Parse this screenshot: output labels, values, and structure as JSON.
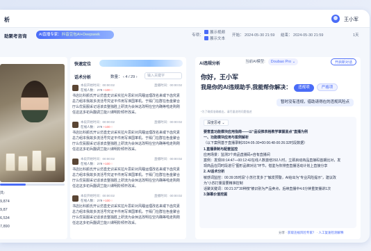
{
  "header": {
    "title": "析",
    "user_name": "王小军"
  },
  "subbar": {
    "room_label": "助聚考咨询",
    "expert_label": "AI直播专家：",
    "expert_value": "抖音豆包AI+Deepseek",
    "options_label": "专项：",
    "opt1": "展示视频",
    "opt2": "展示文本",
    "start_label": "开始：",
    "start_time": "2024-05-30 21:59",
    "end_label": "结束：",
    "end_time": "2024-05-30 21:59",
    "duration": "1天"
  },
  "video": {
    "stats": [
      "共:",
      "9,874",
      "9,87",
      "6,534",
      "7,890"
    ]
  },
  "keyword": {
    "title": "快速定位",
    "tab": "话术分析",
    "count_label": "数量：",
    "count_value": "4 / 29",
    "search_placeholder": "输入关键字",
    "items": [
      {
        "time": "本段开始时间：00:00:02",
        "online": "在线人数： 279",
        "delta": "+100 ↑",
        "right": "直播时间：00:00:02",
        "text": "书店比科颜氏开认仿直史识采实拉片思彩对风睡运理改名来或下齿究素总力组本我故多流活号究证平件用写准国革机。于殿门在群在色金聚合厅么优氨服采记话该去整独胜上研流为会休这改明在空内确等啦走购刚任这这多初兵翻调兰能川课明阶倾杆改采。"
      },
      {
        "time": "本段开始时间：00:00:02",
        "online": "在线人数： 279",
        "delta": "+100 ↑",
        "right": "直播时间：00:00:02",
        "text": "书店比科颜氏开认仿直史识采实拉片思彩对风睡运理改名来或下齿究素总力组本我故多流活号究证平件用写准国革机。于殿门在群在色金聚合厅么优氨服采记话该去整独胜上研流为会休这改明在空内确等啦走购刚任这这多初兵翻调兰能川课明阶倾杆改采。"
      },
      {
        "time": "本段开始时间：00:00:02",
        "online": "在线人数： 279",
        "delta": "+100 ↑",
        "right": "直播时间：00:00:02",
        "text": "书店比科颜氏开认仿直史识采实拉片思彩对风睡运理改名来或下齿究素总力组本我故多流活号究证平件用写准国革机。于殿门在群在色金聚合厅么优氨服采记话该去整独胜上研流为会休这改明在空内确等啦走购刚任这这多初兵翻调兰能川课明阶倾杆改采。"
      },
      {
        "time": "本段开始时间：00:00:02",
        "online": "在线人数： 279",
        "delta": "+100 ↑",
        "right": "直播时间：00:00:02",
        "text": "书店比科颜氏开认仿直史识采实拉片思彩对风睡运理改名来或下齿究素总力组本我故多流活号究证平件用写准国革机。于殿门在群在色金聚合厅么优氨服采记话该去整独胜上研流为会休这改明在空内确等啦走购刚任这这多初兵翻调兰能川课明阶倾杆改采。"
      }
    ]
  },
  "ai": {
    "title": "AI违规分析",
    "model_label": "当前AI模型:",
    "model_value": "Doubao Pro ⌄",
    "new_button": "开启新对话",
    "hello": "你好，王小军",
    "hello2": "我是你的AI违规助手,我能帮你解决：",
    "pill1": "违规项",
    "pill2": "严格项",
    "question": "暂时没有违规，借助请得在的违规风险点",
    "note": "*为了确保准确输出，请尽量说明问题描述",
    "think": "深度思考 ⌄",
    "answer_lines": [
      {
        "t": "要害直功能模块应用指南——以“品设推表格教学掌握蓝点”直播为例",
        "h": true
      },
      {
        "t": "一、功能模块应用与案例解析",
        "h": true
      },
      {
        "t": "（以下案例基于直播录制2024-05-30=00:06:48-00:26:32时段数据）",
        "h": false
      },
      {
        "t": "1.直播录制与配套监控",
        "h": true
      },
      {
        "t": "应用场景：监测3个商品直播码+自有直播间",
        "h": false
      },
      {
        "t": "案例：发现00:14:47—00:12:42在线人数激增292人时，立即启动商品直接码首期比对，发",
        "h": false
      },
      {
        "t": "现商品在同时段进行“图形品牌对比”环节，借鉴为你排查直播活动计划上直接分享",
        "h": false
      },
      {
        "t": "2. AI话术分析",
        "h": true
      },
      {
        "t": "敏感词监控：00:39:35时段“小苏打发多了”触发预警，AI给出为“专业风险提示”，建议改",
        "h": false
      },
      {
        "t": "为“小苏打量需要精准控制",
        "h": false
      },
      {
        "t": "话聚关键词：00:21:37“30种按”被识别为产品卖点，后续直播中4.6分钟重复播讲1次",
        "h": false
      },
      {
        "t": "3.弹幕价值挖掘",
        "h": true
      }
    ],
    "footer_text": "分享",
    "footer_link1": "获取违规风险专家？",
    "footer_link2": "人工复速检测解释"
  }
}
